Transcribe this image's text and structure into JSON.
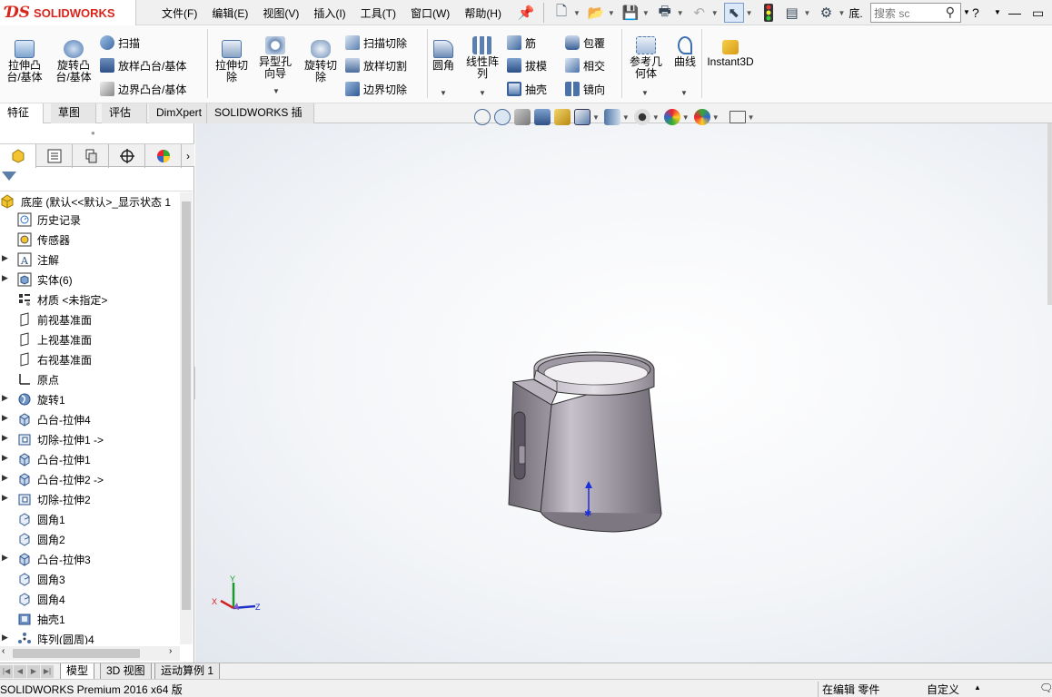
{
  "app": {
    "brand": "SOLIDWORKS"
  },
  "menu": [
    "文件(F)",
    "编辑(E)",
    "视图(V)",
    "插入(I)",
    "工具(T)",
    "窗口(W)",
    "帮助(H)"
  ],
  "search": {
    "placeholder": "搜索 sc"
  },
  "toolbar_truncated": "底.",
  "ribbon": {
    "extrude_boss": "拉伸凸\n台/基体",
    "revolve_boss": "旋转凸\n台/基体",
    "sweep": "扫描",
    "loft_boss": "放样凸台/基体",
    "boundary_boss": "边界凸台/基体",
    "extrude_cut": "拉伸切\n除",
    "hole_wizard": "异型孔\n向导",
    "revolve_cut": "旋转切\n除",
    "swept_cut": "扫描切除",
    "lofted_cut": "放样切割",
    "boundary_cut": "边界切除",
    "fillet": "圆角",
    "linear_pattern": "线性阵\n列",
    "rib": "筋",
    "draft": "拔模",
    "shell": "抽壳",
    "wrap": "包覆",
    "intersect": "相交",
    "mirror": "镜向",
    "ref_geometry": "参考几\n何体",
    "curves": "曲线",
    "instant3d": "Instant3D"
  },
  "command_tabs": [
    "特征",
    "草图",
    "评估",
    "DimXpert",
    "SOLIDWORKS 插件"
  ],
  "tree": {
    "root": "底座 (默认<<默认>_显示状态 1",
    "items": [
      {
        "label": "历史记录",
        "icon": "history-icon",
        "expandable": false
      },
      {
        "label": "传感器",
        "icon": "sensor-icon",
        "expandable": false
      },
      {
        "label": "注解",
        "icon": "annotation-icon",
        "expandable": true
      },
      {
        "label": "实体(6)",
        "icon": "solid-bodies-icon",
        "expandable": true
      },
      {
        "label": "材质 <未指定>",
        "icon": "material-icon",
        "expandable": false
      },
      {
        "label": "前视基准面",
        "icon": "plane-icon",
        "expandable": false
      },
      {
        "label": "上视基准面",
        "icon": "plane-icon",
        "expandable": false
      },
      {
        "label": "右视基准面",
        "icon": "plane-icon",
        "expandable": false
      },
      {
        "label": "原点",
        "icon": "origin-icon",
        "expandable": false
      },
      {
        "label": "旋转1",
        "icon": "revolve-feature-icon",
        "expandable": true
      },
      {
        "label": "凸台-拉伸4",
        "icon": "extrude-feature-icon",
        "expandable": true
      },
      {
        "label": "切除-拉伸1 ->",
        "icon": "cut-feature-icon",
        "expandable": true
      },
      {
        "label": "凸台-拉伸1",
        "icon": "extrude-feature-icon",
        "expandable": true
      },
      {
        "label": "凸台-拉伸2 ->",
        "icon": "extrude-feature-icon",
        "expandable": true
      },
      {
        "label": "切除-拉伸2",
        "icon": "cut-feature-icon",
        "expandable": true
      },
      {
        "label": "圆角1",
        "icon": "fillet-feature-icon",
        "expandable": false
      },
      {
        "label": "圆角2",
        "icon": "fillet-feature-icon",
        "expandable": false
      },
      {
        "label": "凸台-拉伸3",
        "icon": "extrude-feature-icon",
        "expandable": true
      },
      {
        "label": "圆角3",
        "icon": "fillet-feature-icon",
        "expandable": false
      },
      {
        "label": "圆角4",
        "icon": "fillet-feature-icon",
        "expandable": false
      },
      {
        "label": "抽壳1",
        "icon": "shell-feature-icon",
        "expandable": false
      },
      {
        "label": "阵列(圆周)4",
        "icon": "pattern-feature-icon",
        "expandable": true
      }
    ]
  },
  "triad": {
    "x": "X",
    "y": "Y",
    "z": "Z"
  },
  "bottom_tabs": [
    "模型",
    "3D 视图",
    "运动算例 1"
  ],
  "status": {
    "product": "SOLIDWORKS Premium 2016 x64 版",
    "mode": "在编辑 零件",
    "custom": "自定义"
  }
}
